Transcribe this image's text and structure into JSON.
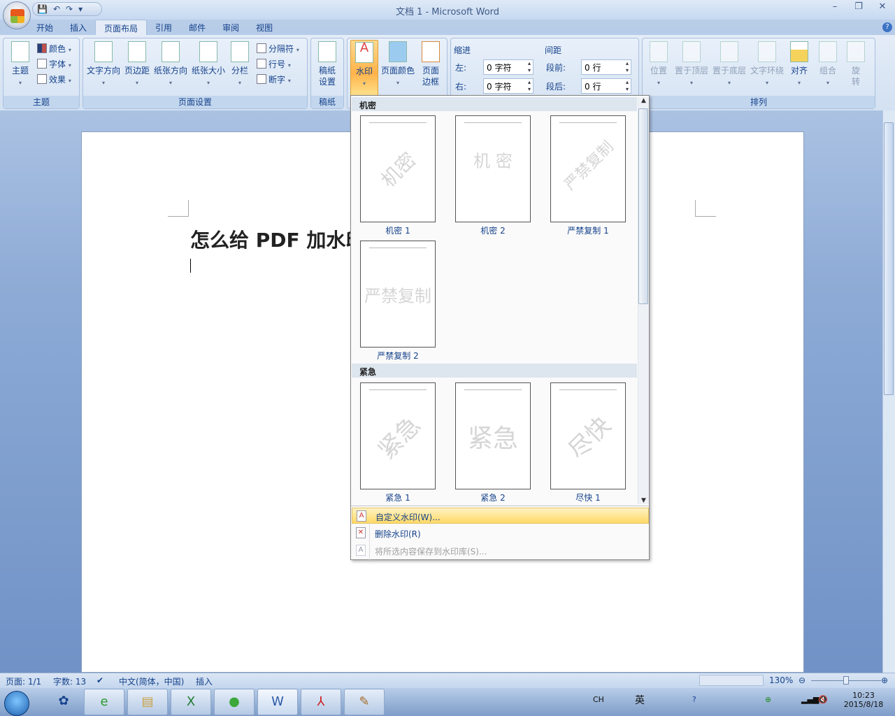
{
  "window": {
    "title": "文档 1 - Microsoft Word",
    "minimize": "–",
    "restore": "❐",
    "close": "✕",
    "help": "?"
  },
  "qat": {
    "save": "💾",
    "undo": "↶",
    "redo": "↷",
    "more": "▾"
  },
  "tabs": [
    "开始",
    "插入",
    "页面布局",
    "引用",
    "邮件",
    "审阅",
    "视图"
  ],
  "active_tab": "页面布局",
  "ribbon": {
    "theme_group": {
      "label": "主题",
      "theme": "主题",
      "colors": "颜色",
      "fonts": "字体",
      "effects": "效果"
    },
    "page_setup": {
      "label": "页面设置",
      "text_direction": "文字方向",
      "margins": "页边距",
      "orientation": "纸张方向",
      "size": "纸张大小",
      "columns": "分栏",
      "breaks": "分隔符",
      "line_numbers": "行号",
      "hyphenation": "断字"
    },
    "manuscript": {
      "label": "稿纸",
      "setup": "稿纸设置"
    },
    "background": {
      "watermark": "水印",
      "page_color": "页面颜色",
      "page_borders": "页面边框"
    },
    "paragraph": {
      "indent": "缩进",
      "left_label": "左:",
      "left_value": "0 字符",
      "right_label": "右:",
      "right_value": "0 字符",
      "spacing": "间距",
      "before_label": "段前:",
      "before_value": "0 行",
      "after_label": "段后:",
      "after_value": "0 行"
    },
    "arrange": {
      "label": "排列",
      "position": "位置",
      "bring_front": "置于顶层",
      "send_back": "置于底层",
      "text_wrap": "文字环绕",
      "align": "对齐",
      "group": "组合",
      "rotate": "旋转"
    }
  },
  "document": {
    "heading": "怎么给 PDF 加水印"
  },
  "watermark_gallery": {
    "sections": [
      {
        "title": "机密",
        "items": [
          {
            "label": "机密 1",
            "text": "机密",
            "diagonal": true
          },
          {
            "label": "机密 2",
            "text": "机 密",
            "diagonal": false
          },
          {
            "label": "严禁复制 1",
            "text": "严禁复制",
            "diagonal": true
          },
          {
            "label": "严禁复制 2",
            "text": "严禁复制",
            "diagonal": false
          }
        ]
      },
      {
        "title": "紧急",
        "items": [
          {
            "label": "紧急 1",
            "text": "紧急",
            "diagonal": true
          },
          {
            "label": "紧急 2",
            "text": "紧急",
            "diagonal": false
          },
          {
            "label": "尽快 1",
            "text": "尽快",
            "diagonal": true
          }
        ]
      }
    ],
    "menu": [
      {
        "label": "自定义水印(W)...",
        "highlighted": true,
        "disabled": false
      },
      {
        "label": "删除水印(R)",
        "highlighted": false,
        "disabled": false
      },
      {
        "label": "将所选内容保存到水印库(S)...",
        "highlighted": false,
        "disabled": true
      }
    ]
  },
  "status": {
    "page": "页面: 1/1",
    "words": "字数: 13",
    "language": "中文(简体，中国)",
    "mode": "插入",
    "zoom": "130%",
    "zoom_percent": 130
  },
  "taskbar": {
    "tray_lang": "CH",
    "ime": "英",
    "time": "10:23",
    "date": "2015/8/18"
  }
}
